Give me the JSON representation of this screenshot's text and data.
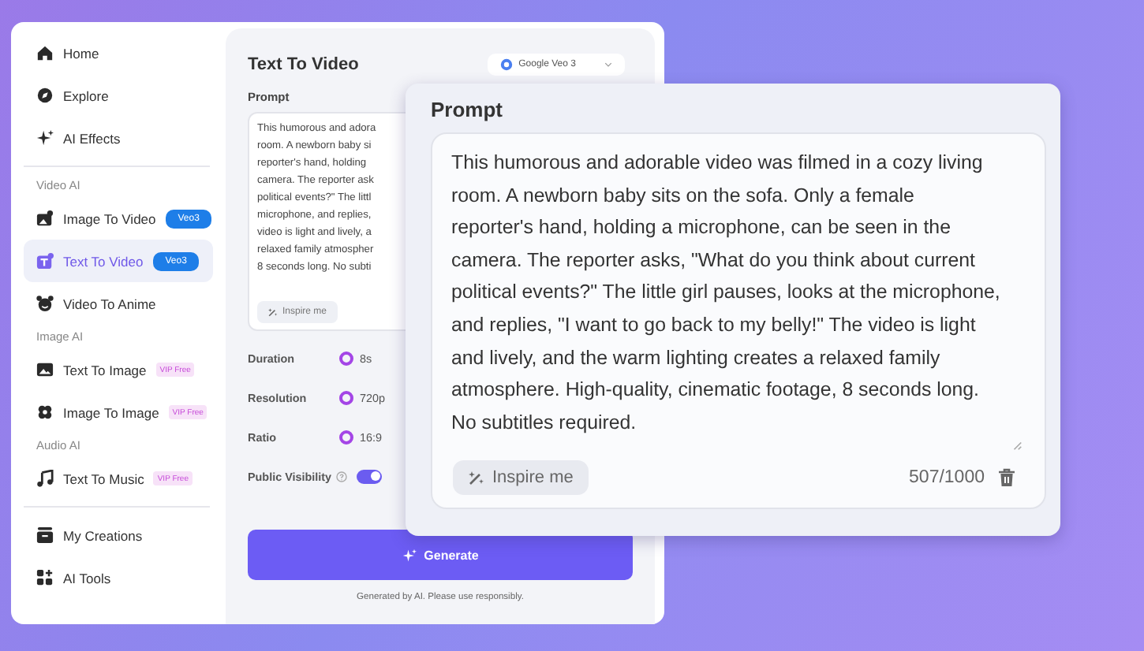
{
  "sidebar": {
    "top": [
      {
        "label": "Home",
        "kind": "home",
        "selected": false
      },
      {
        "label": "Explore",
        "kind": "compass",
        "selected": false
      },
      {
        "label": "AI Effects",
        "kind": "sparkle",
        "selected": false
      }
    ],
    "groups": [
      {
        "label": "Video AI",
        "items": [
          {
            "label": "Image To Video",
            "kind": "image-video",
            "selected": false,
            "badge": {
              "text": "Veo3",
              "kind": "model"
            }
          },
          {
            "label": "Text To Video",
            "kind": "text-video",
            "selected": true,
            "badge": {
              "text": "Veo3",
              "kind": "model"
            }
          },
          {
            "label": "Video To Anime",
            "kind": "bear",
            "selected": false
          }
        ]
      },
      {
        "label": "Image AI",
        "items": [
          {
            "label": "Text To Image",
            "kind": "image",
            "selected": false,
            "badge": {
              "text": "VIP Free",
              "kind": "vip"
            }
          },
          {
            "label": "Image To Image",
            "kind": "flower",
            "selected": false,
            "badge": {
              "text": "VIP Free",
              "kind": "vip"
            }
          }
        ]
      },
      {
        "label": "Audio AI",
        "items": [
          {
            "label": "Text To Music",
            "kind": "music",
            "selected": false,
            "badge": {
              "text": "VIP Free",
              "kind": "vip"
            }
          }
        ]
      }
    ],
    "bottom": [
      {
        "label": "My Creations",
        "kind": "box",
        "selected": false
      },
      {
        "label": "AI Tools",
        "kind": "grid",
        "selected": false
      }
    ]
  },
  "panel": {
    "title": "Text To Video",
    "model": "Google Veo 3",
    "prompt_label": "Prompt",
    "prompt_lines": [
      "This humorous and adora",
      "room. A newborn baby si",
      "reporter's hand, holding",
      "camera. The reporter ask",
      "political events?\" The littl",
      "microphone, and replies,",
      "video is light and lively, a",
      "relaxed family atmospher",
      "8 seconds long. No subti"
    ],
    "inspire": "Inspire me",
    "options": [
      {
        "label": "Duration",
        "value": "8s"
      },
      {
        "label": "Resolution",
        "value": "720p"
      },
      {
        "label": "Ratio",
        "value": "16:9"
      }
    ],
    "visibility": {
      "label": "Public Visibility",
      "on": true
    },
    "generate": "Generate",
    "footer": "Generated by AI. Please use responsibly."
  },
  "zoom": {
    "title": "Prompt",
    "text": "This humorous and adorable video was filmed in a cozy living room. A newborn baby sits on the sofa. Only a female reporter's hand, holding a microphone, can be seen in the camera. The reporter asks, \"What do you think about current political events?\" The little girl pauses, looks at the microphone, and replies, \"I want to go back to my belly!\" The video is light and lively, and the warm lighting creates a relaxed family atmosphere. High-quality, cinematic footage, 8 seconds long. No subtitles required.",
    "inspire": "Inspire me",
    "count": "507/1000"
  }
}
